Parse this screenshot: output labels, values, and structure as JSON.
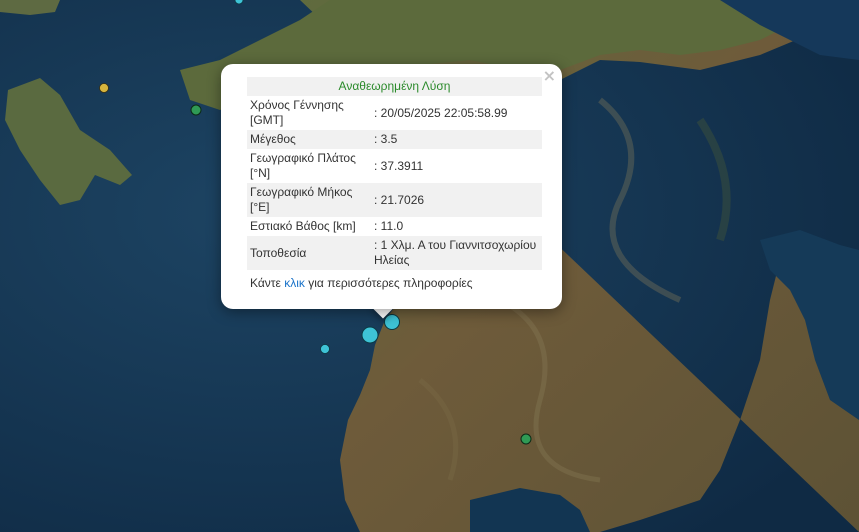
{
  "popup": {
    "title": "Αναθεωρημένη Λύση",
    "rows": [
      {
        "label": "Χρόνος Γέννησης [GMT]",
        "value": ": 20/05/2025 22:05:58.99"
      },
      {
        "label": "Μέγεθος",
        "value": ": 3.5"
      },
      {
        "label": "Γεωγραφικό Πλάτος [°N]",
        "value": ": 37.3911"
      },
      {
        "label": "Γεωγραφικό Μήκος [°E]",
        "value": ": 21.7026"
      },
      {
        "label": "Εστιακό Βάθος [km]",
        "value": ": 11.0"
      },
      {
        "label": "Τοποθεσία",
        "value": ": 1 Χλμ. Α του Γιαννιτσοχωρίου Ηλείας"
      }
    ],
    "more_prefix": "Κάντε",
    "more_link": "κλικ",
    "more_suffix": "για περισσότερες πληροφορίες",
    "close": "×"
  },
  "colors": {
    "sea": "#163a55",
    "land": "#6b5a3c",
    "marker_cyan": "#3ec3d6",
    "marker_green": "#2f9a55",
    "marker_yellow": "#d7b53d"
  }
}
